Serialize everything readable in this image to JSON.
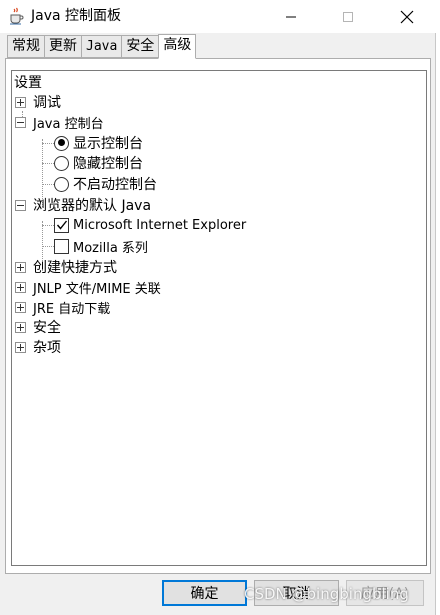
{
  "window": {
    "title": "Java 控制面板",
    "icon": "java-coffee-icon"
  },
  "tabs": [
    {
      "label": "常规",
      "active": false
    },
    {
      "label": "更新",
      "active": false
    },
    {
      "label": "Java",
      "active": false
    },
    {
      "label": "安全",
      "active": false
    },
    {
      "label": "高级",
      "active": true
    }
  ],
  "tree": {
    "root": "设置",
    "debug": "调试",
    "java_console": "Java 控制台",
    "show_console": "显示控制台",
    "hide_console": "隐藏控制台",
    "no_console": "不启动控制台",
    "browser_default": "浏览器的默认 Java",
    "ie": "Microsoft Internet Explorer",
    "mozilla": "Mozilla 系列",
    "shortcut": "创建快捷方式",
    "jnlp": "JNLP 文件/MIME 关联",
    "jre_auto": "JRE 自动下载",
    "security": "安全",
    "misc": "杂项"
  },
  "buttons": {
    "ok": "确定",
    "cancel": "取消",
    "apply": "应用(A)"
  },
  "watermark": "CSDN @bingbingbling",
  "colors": {
    "accent": "#0078d7",
    "tree_border": "#7a7a7a"
  }
}
